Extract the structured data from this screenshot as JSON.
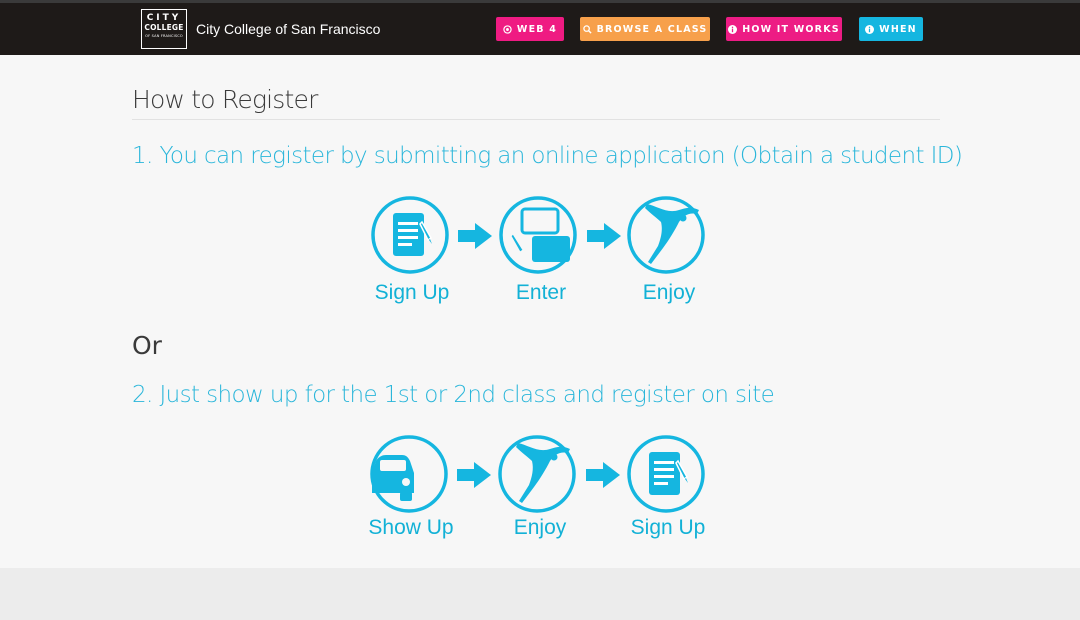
{
  "header": {
    "logo": {
      "line1": "CITY",
      "line2": "COLLEGE",
      "line3": "OF SAN FRANCISCO"
    },
    "brand_name": "City College of San Francisco",
    "nav": [
      {
        "label": "WEB 4",
        "icon": "target-icon",
        "color": "#ef1b82"
      },
      {
        "label": "BROWSE A CLASS",
        "icon": "search-icon",
        "color": "#f7a04b"
      },
      {
        "label": "HOW IT WORKS",
        "icon": "info-icon",
        "color": "#ed1c84"
      },
      {
        "label": "WHEN",
        "icon": "info-icon",
        "color": "#15b6e0"
      }
    ]
  },
  "main": {
    "title": "How to Register",
    "option1": {
      "heading": "1. You can register by submitting an online application (Obtain a student ID)",
      "steps": [
        {
          "label": "Sign Up",
          "icon": "document-pencil-icon"
        },
        {
          "label": "Enter",
          "icon": "form-windows-icon"
        },
        {
          "label": "Enjoy",
          "icon": "dancer-icon"
        }
      ]
    },
    "or_text": "Or",
    "option2": {
      "heading": "2. Just show up for the 1st or 2nd class and register on site",
      "steps": [
        {
          "label": "Show Up",
          "icon": "car-icon"
        },
        {
          "label": "Enjoy",
          "icon": "dancer-icon"
        },
        {
          "label": "Sign Up",
          "icon": "document-pencil-icon"
        }
      ]
    }
  },
  "colors": {
    "accent": "#15b6e0",
    "header_bg": "#1e1a18"
  }
}
